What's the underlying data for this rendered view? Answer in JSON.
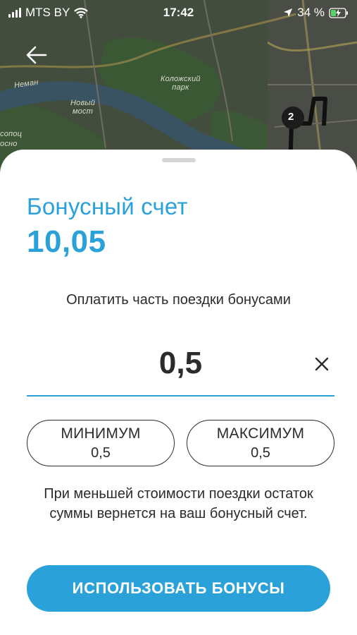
{
  "status_bar": {
    "carrier": "MTS BY",
    "time": "17:42",
    "battery": "34 %"
  },
  "map": {
    "labels": {
      "park": "Коложский\nпарк",
      "bridge": "Новый\nмост",
      "river": "Неман",
      "left_edge_1": "сопоц",
      "left_edge_2": "осно",
      "marker": "2"
    }
  },
  "sheet": {
    "title": "Бонусный счет",
    "balance": "10,05",
    "pay_label": "Оплатить часть поездки бонусами",
    "amount_value": "0,5",
    "min_chip": {
      "label": "МИНИМУМ",
      "value": "0,5"
    },
    "max_chip": {
      "label": "МАКСИМУМ",
      "value": "0,5"
    },
    "note": "При меньшей стоимости поездки остаток суммы вернется на ваш бонусный счет.",
    "use_button": "ИСПОЛЬЗОВАТЬ БОНУСЫ"
  },
  "colors": {
    "accent": "#2aa1d9",
    "text": "#2b2b2b",
    "map_bg": "#3f4a3a"
  }
}
